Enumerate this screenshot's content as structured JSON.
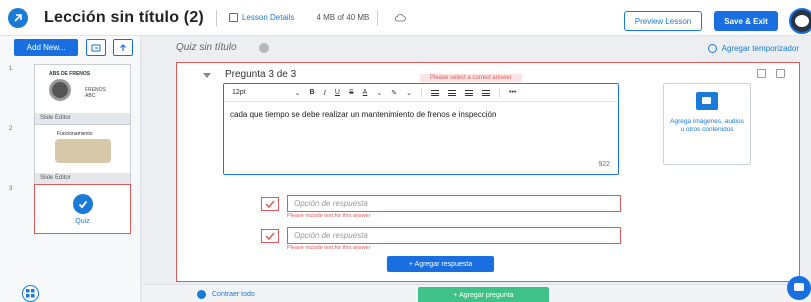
{
  "header": {
    "title": "Lección sin título (2)",
    "lesson_details": "Lesson Details",
    "storage": "4 MB of 40 MB",
    "preview_label": "Preview Lesson",
    "save_exit_label": "Save & Exit"
  },
  "sidebar": {
    "add_new_label": "Add New...",
    "slides": [
      {
        "number": "1",
        "thumb_title": "ABS DE FRENOS",
        "thumb_text": "FRENOS ABC",
        "label": "Slide Editor"
      },
      {
        "number": "2",
        "thumb_title": "Funcionamiento",
        "label": "Slide Editor"
      },
      {
        "number": "3",
        "label": "Quiz"
      }
    ]
  },
  "main": {
    "quiz_title": "Quiz sin título",
    "timer_label": "Agregar temporizador",
    "question": {
      "title": "Pregunta 3 de 3",
      "warning": "Please select a correct answer",
      "editor": {
        "font_size": "12pt",
        "text": "cada que tiempo se debe realizar un mantenimiento de frenos e inspección",
        "char_count": "922"
      },
      "media_text": "Agrega imágenes, audios u otros contenidos",
      "answers": [
        {
          "placeholder": "Opción de respuesta",
          "error": "Please include text for this answer"
        },
        {
          "placeholder": "Opción de respuesta",
          "error": "Please include text for this answer"
        }
      ],
      "add_answer_label": "+ Agregar respuesta"
    }
  },
  "footer": {
    "collapse_label": "Contraer todo",
    "add_question_label": "+ Agregar pregunta"
  },
  "colors": {
    "accent": "#1a6fe0",
    "error": "#e05a5a",
    "success": "#3ec28a"
  }
}
